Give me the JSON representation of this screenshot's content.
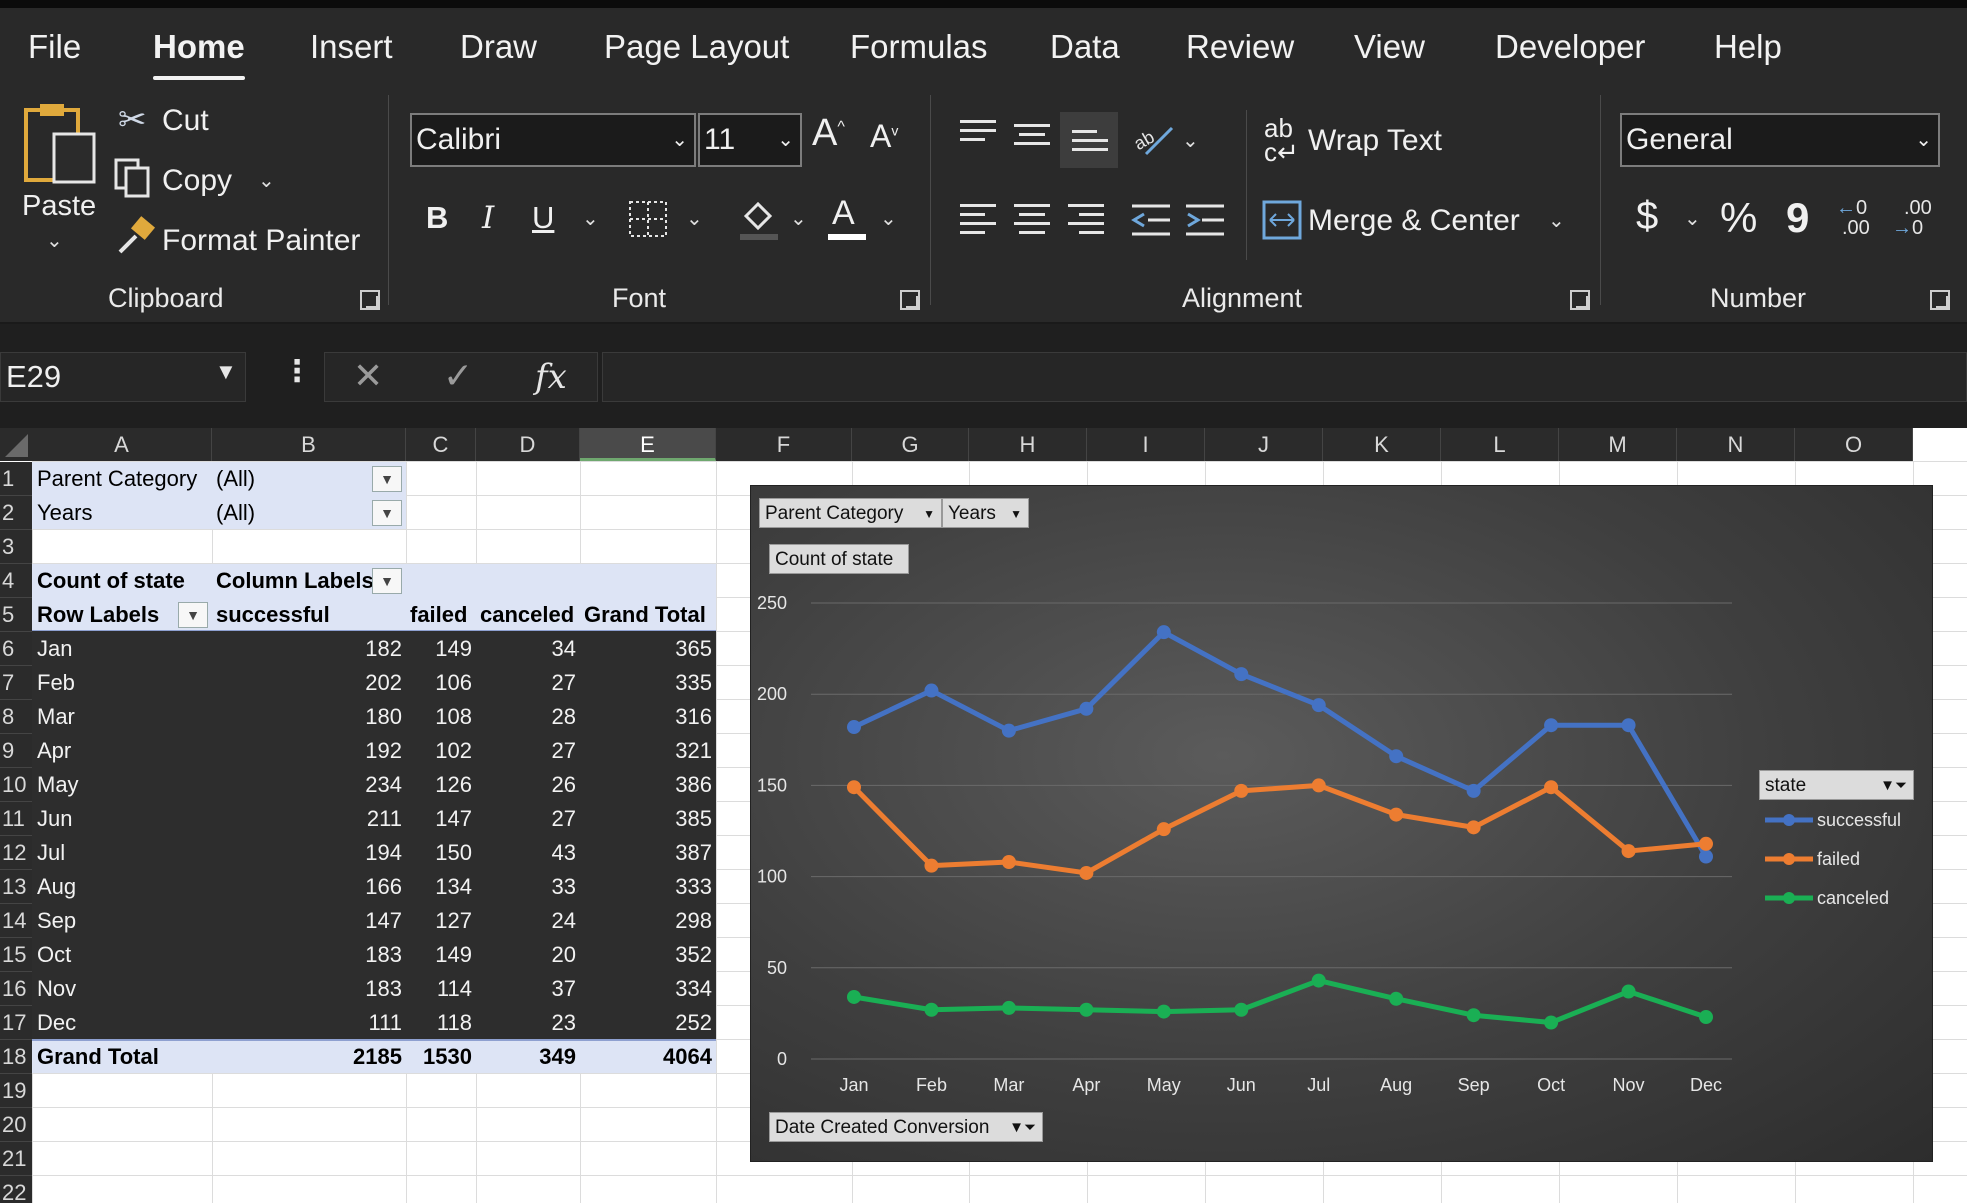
{
  "menu_tabs": [
    "File",
    "Home",
    "Insert",
    "Draw",
    "Page Layout",
    "Formulas",
    "Data",
    "Review",
    "View",
    "Developer",
    "Help"
  ],
  "active_tab": "Home",
  "ribbon": {
    "clipboard": {
      "paste": "Paste",
      "cut": "Cut",
      "copy": "Copy",
      "format_painter": "Format Painter",
      "label": "Clipboard"
    },
    "font": {
      "name": "Calibri",
      "size": "11",
      "bold": "B",
      "italic": "I",
      "underline": "U",
      "font_color": "A",
      "grow": "A",
      "shrink": "A",
      "label": "Font"
    },
    "alignment": {
      "wrap_text": "Wrap Text",
      "merge_center": "Merge & Center",
      "label": "Alignment"
    },
    "number": {
      "format": "General",
      "currency": "$",
      "percent": "%",
      "comma": "9",
      "inc_decimal_top": "0",
      "inc_decimal_bottom": ".00",
      "dec_decimal_top": ".00",
      "dec_decimal_bottom": "0",
      "label": "Number"
    }
  },
  "formula_bar": {
    "name_box": "E29",
    "fx": "fx",
    "content": ""
  },
  "columns": [
    "A",
    "B",
    "C",
    "D",
    "E",
    "F",
    "G",
    "H",
    "I",
    "J",
    "K",
    "L",
    "M",
    "N",
    "O"
  ],
  "selected_column": "E",
  "rows": [
    "1",
    "2",
    "3",
    "4",
    "5",
    "6",
    "7",
    "8",
    "9",
    "10",
    "11",
    "12",
    "13",
    "14",
    "15",
    "16",
    "17",
    "18",
    "19",
    "20",
    "21",
    "22"
  ],
  "pivot": {
    "filters": [
      {
        "label": "Parent Category",
        "value": "(All)"
      },
      {
        "label": "Years",
        "value": "(All)"
      }
    ],
    "count_label": "Count of state",
    "column_labels": "Column Labels",
    "row_labels": "Row Labels",
    "headers": [
      "successful",
      "failed",
      "canceled",
      "Grand Total"
    ],
    "data": [
      {
        "month": "Jan",
        "v": [
          "182",
          "149",
          "34",
          "365"
        ]
      },
      {
        "month": "Feb",
        "v": [
          "202",
          "106",
          "27",
          "335"
        ]
      },
      {
        "month": "Mar",
        "v": [
          "180",
          "108",
          "28",
          "316"
        ]
      },
      {
        "month": "Apr",
        "v": [
          "192",
          "102",
          "27",
          "321"
        ]
      },
      {
        "month": "May",
        "v": [
          "234",
          "126",
          "26",
          "386"
        ]
      },
      {
        "month": "Jun",
        "v": [
          "211",
          "147",
          "27",
          "385"
        ]
      },
      {
        "month": "Jul",
        "v": [
          "194",
          "150",
          "43",
          "387"
        ]
      },
      {
        "month": "Aug",
        "v": [
          "166",
          "134",
          "33",
          "333"
        ]
      },
      {
        "month": "Sep",
        "v": [
          "147",
          "127",
          "24",
          "298"
        ]
      },
      {
        "month": "Oct",
        "v": [
          "183",
          "149",
          "20",
          "352"
        ]
      },
      {
        "month": "Nov",
        "v": [
          "183",
          "114",
          "37",
          "334"
        ]
      },
      {
        "month": "Dec",
        "v": [
          "111",
          "118",
          "23",
          "252"
        ]
      }
    ],
    "grand_total": {
      "label": "Grand Total",
      "v": [
        "2185",
        "1530",
        "349",
        "4064"
      ]
    }
  },
  "chart_buttons": {
    "parent_category": "Parent Category",
    "years": "Years",
    "count_of_state": "Count of state",
    "date_field": "Date Created Conversion",
    "legend_title": "state"
  },
  "chart_data": {
    "type": "line",
    "categories": [
      "Jan",
      "Feb",
      "Mar",
      "Apr",
      "May",
      "Jun",
      "Jul",
      "Aug",
      "Sep",
      "Oct",
      "Nov",
      "Dec"
    ],
    "series": [
      {
        "name": "successful",
        "color": "#4472c4",
        "values": [
          182,
          202,
          180,
          192,
          234,
          211,
          194,
          166,
          147,
          183,
          183,
          111
        ]
      },
      {
        "name": "failed",
        "color": "#ed7d31",
        "values": [
          149,
          106,
          108,
          102,
          126,
          147,
          150,
          134,
          127,
          149,
          114,
          118
        ]
      },
      {
        "name": "canceled",
        "color": "#1aaf54",
        "values": [
          34,
          27,
          28,
          27,
          26,
          27,
          43,
          33,
          24,
          20,
          37,
          23
        ]
      }
    ],
    "ylim": [
      0,
      250
    ],
    "yticks": [
      "0",
      "50",
      "100",
      "150",
      "200",
      "250"
    ],
    "grid": true,
    "legend": "right"
  }
}
